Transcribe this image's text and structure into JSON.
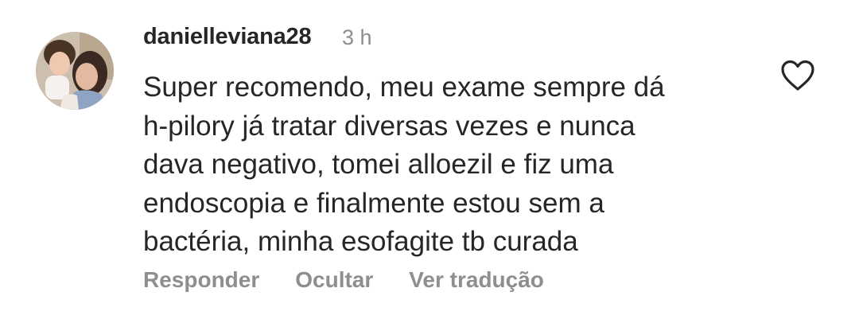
{
  "comment": {
    "username": "danielleviana28",
    "time": "3 h",
    "text_lines": [
      "Super recomendo, meu exame sempre dá",
      "h-pilory já tratar diversas vezes e nunca",
      "dava negativo, tomei alloezil e fiz uma",
      "endoscopia e finalmente estou sem a",
      "bactéria, minha esofagite tb curada"
    ],
    "actions": {
      "reply": "Responder",
      "hide": "Ocultar",
      "translate": "Ver tradução"
    },
    "like_icon": "heart-outline-icon"
  },
  "colors": {
    "primary_text": "#262626",
    "secondary_text": "#8e8e8e",
    "background": "#ffffff"
  }
}
